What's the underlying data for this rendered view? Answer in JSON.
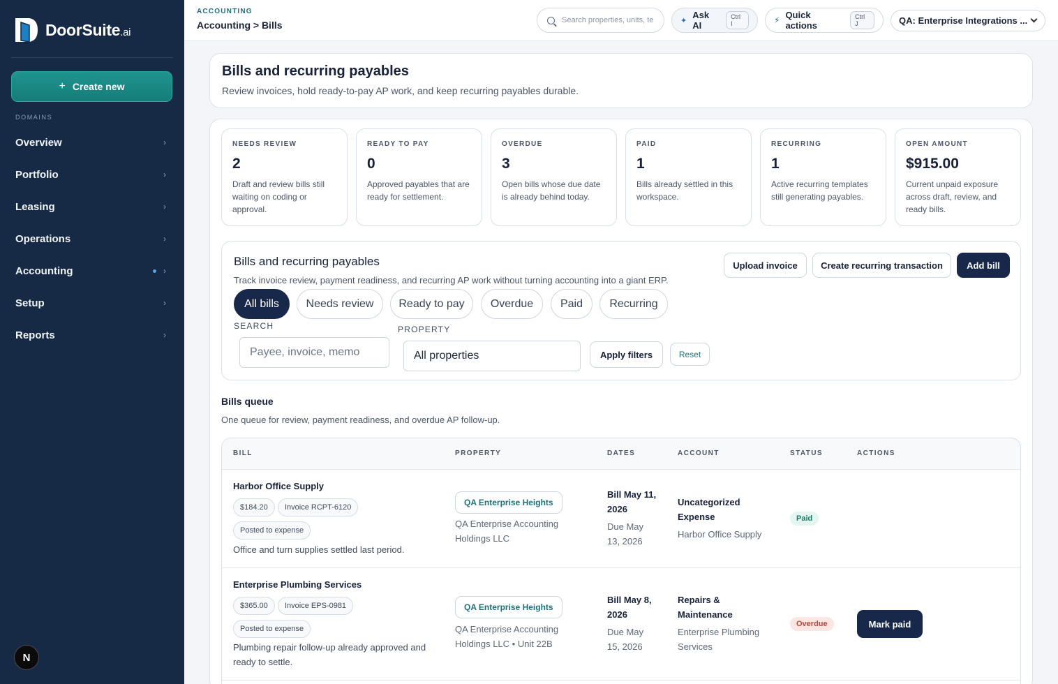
{
  "app": {
    "brand": "DoorSuite",
    "brand_suffix": ".ai",
    "create_new": "Create new",
    "domains_label": "DOMAINS",
    "nav": [
      {
        "label": "Overview"
      },
      {
        "label": "Portfolio"
      },
      {
        "label": "Leasing"
      },
      {
        "label": "Operations"
      },
      {
        "label": "Accounting",
        "active": true
      },
      {
        "label": "Setup"
      },
      {
        "label": "Reports"
      }
    ],
    "next_badge": "N"
  },
  "topbar": {
    "section": "ACCOUNTING",
    "breadcrumb": "Accounting > Bills",
    "search_placeholder": "Search properties, units, te",
    "ask_ai": "Ask AI",
    "ask_ai_kbd": "Ctrl I",
    "quick_actions": "Quick actions",
    "quick_actions_kbd": "Ctrl J",
    "workspace": "QA: Enterprise Integrations ..."
  },
  "header": {
    "title": "Bills and recurring payables",
    "subtitle": "Review invoices, hold ready-to-pay AP work, and keep recurring payables durable."
  },
  "kpis": [
    {
      "label": "NEEDS REVIEW",
      "value": "2",
      "desc": "Draft and review bills still waiting on coding or approval."
    },
    {
      "label": "READY TO PAY",
      "value": "0",
      "desc": "Approved payables that are ready for settlement."
    },
    {
      "label": "OVERDUE",
      "value": "3",
      "desc": "Open bills whose due date is already behind today."
    },
    {
      "label": "PAID",
      "value": "1",
      "desc": "Bills already settled in this workspace."
    },
    {
      "label": "RECURRING",
      "value": "1",
      "desc": "Active recurring templates still generating payables."
    },
    {
      "label": "OPEN AMOUNT",
      "value": "$915.00",
      "desc": "Current unpaid exposure across draft, review, and ready bills."
    }
  ],
  "filters": {
    "title": "Bills and recurring payables",
    "subtitle": "Track invoice review, payment readiness, and recurring AP work without turning accounting into a giant ERP.",
    "upload_invoice": "Upload invoice",
    "create_recurring": "Create recurring transaction",
    "add_bill": "Add bill",
    "chips": [
      "All bills",
      "Needs review",
      "Ready to pay",
      "Overdue",
      "Paid",
      "Recurring"
    ],
    "search_label": "SEARCH",
    "search_placeholder": "Payee, invoice, memo",
    "property_label": "PROPERTY",
    "property_value": "All properties",
    "apply": "Apply filters",
    "reset": "Reset"
  },
  "queue": {
    "title": "Bills queue",
    "subtitle": "One queue for review, payment readiness, and overdue AP follow-up.",
    "columns": [
      "BILL",
      "PROPERTY",
      "DATES",
      "ACCOUNT",
      "STATUS",
      "ACTIONS"
    ],
    "rows": [
      {
        "payee": "Harbor Office Supply",
        "amount": "$184.20",
        "invoice": "Invoice RCPT-6120",
        "posting": "Posted to expense",
        "memo": "Office and turn supplies settled last period.",
        "property": "QA Enterprise Heights",
        "property_sub": "QA Enterprise Accounting Holdings LLC",
        "bill_date": "Bill May 11, 2026",
        "due_date": "Due May 13, 2026",
        "account": "Uncategorized Expense",
        "account_sub": "Harbor Office Supply",
        "status": "Paid",
        "action": ""
      },
      {
        "payee": "Enterprise Plumbing Services",
        "amount": "$365.00",
        "invoice": "Invoice EPS-0981",
        "posting": "Posted to expense",
        "memo": "Plumbing repair follow-up already approved and ready to settle.",
        "property": "QA Enterprise Heights",
        "property_sub": "QA Enterprise Accounting Holdings LLC • Unit 22B",
        "bill_date": "Bill May 8, 2026",
        "due_date": "Due May 15, 2026",
        "account": "Repairs & Maintenance",
        "account_sub": "Enterprise Plumbing Services",
        "status": "Overdue",
        "action": "Mark paid"
      }
    ]
  },
  "colors": {
    "sidebar": "#172a45",
    "accent_teal": "#1f948f",
    "primary_dark": "#17284a",
    "paid_bg": "#e3f6f1",
    "overdue_bg": "#fbe6e2"
  }
}
